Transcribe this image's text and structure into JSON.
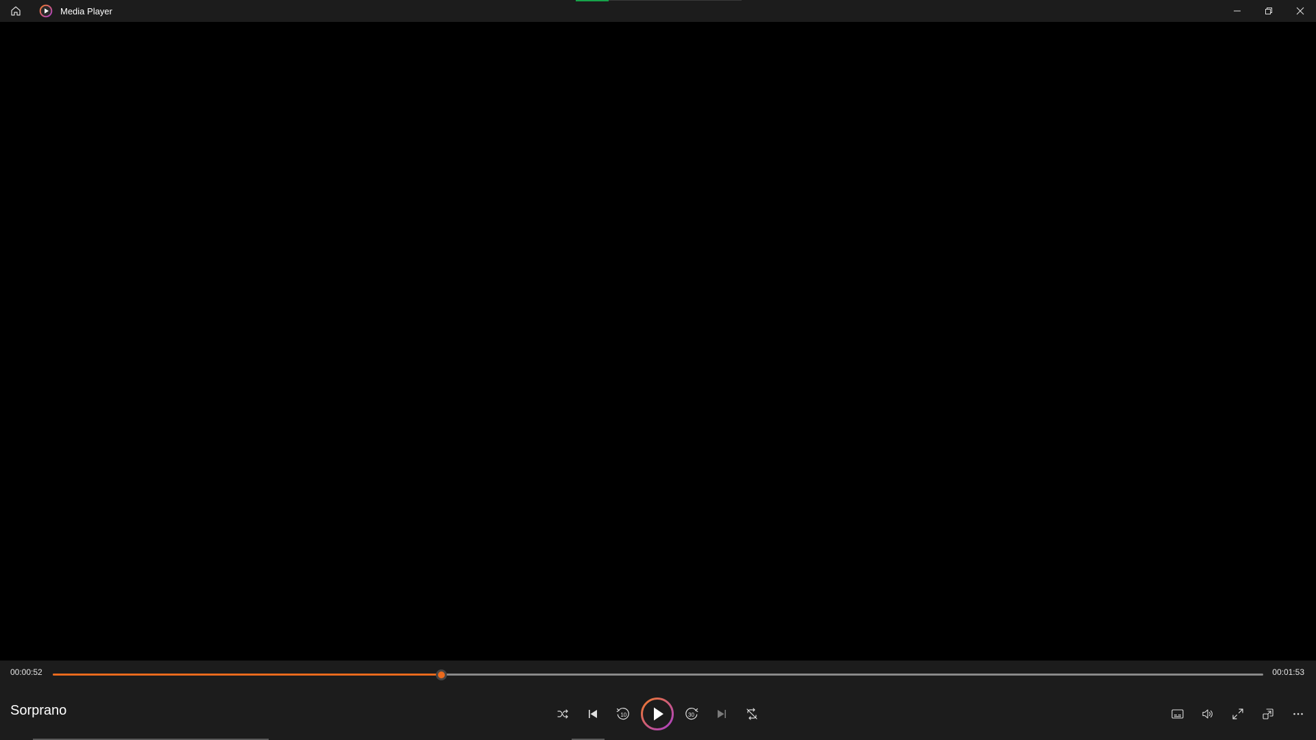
{
  "window": {
    "title": "Media Player"
  },
  "player": {
    "elapsed": "00:00:52",
    "total": "00:01:53",
    "progress": 0.321,
    "track_title": "Sorprano"
  },
  "icons": {
    "home": "home-icon",
    "app": "media-player-app-icon",
    "minimize": "minimize-icon",
    "restore": "restore-icon",
    "close": "close-icon",
    "shuffle": "shuffle-icon",
    "previous": "previous-icon",
    "skip_back": "skip-back-10-icon",
    "play": "play-icon",
    "skip_forward": "skip-forward-30-icon",
    "next": "next-icon",
    "repeat": "repeat-off-icon",
    "captions": "captions-icon",
    "volume": "volume-icon",
    "fullscreen": "fullscreen-icon",
    "mini_player": "mini-player-icon",
    "more": "more-options-icon"
  },
  "skip_labels": {
    "back": "10",
    "forward": "30"
  },
  "colors": {
    "accent": "#ea6a1d",
    "play_ring_start": "#f07a2a",
    "play_ring_end": "#a93ec9",
    "titlebar": "#1c1c1c",
    "background": "#000000",
    "window_accent": "#16a34a"
  }
}
